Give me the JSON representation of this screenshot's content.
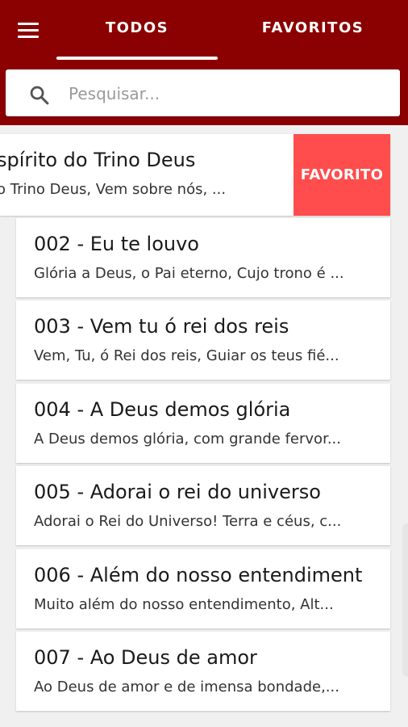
{
  "header": {
    "tabs": [
      {
        "label": "TODOS"
      },
      {
        "label": "FAVORITOS"
      }
    ],
    "active_tab": "TODOS",
    "colors": {
      "primary": "#8b0000",
      "favorite_action": "#ff4c4c"
    }
  },
  "search": {
    "placeholder": "Pesquisar...",
    "icon": "search-icon"
  },
  "swiped_item": {
    "title": "spírito do Trino Deus",
    "subtitle": "o Trino Deus, Vem sobre nós, ...",
    "action_label": "FAVORITO"
  },
  "hymns": [
    {
      "title": "002 - Eu te louvo",
      "subtitle": "Glória a Deus, o Pai eterno, Cujo trono é ..."
    },
    {
      "title": "003 - Vem tu ó rei dos reis",
      "subtitle": "Vem, Tu, ó Rei dos reis, Guiar os teus fié..."
    },
    {
      "title": "004 - A Deus demos glória",
      "subtitle": "A Deus demos glória, com grande fervor..."
    },
    {
      "title": "005 - Adorai o rei do universo",
      "subtitle": "Adorai o Rei do Universo! Terra e céus, c..."
    },
    {
      "title": "006 - Além do nosso entendiment",
      "subtitle": "Muito além do nosso entendimento, Alt..."
    },
    {
      "title": "007 - Ao Deus de amor",
      "subtitle": "Ao Deus de amor e de imensa bondade,..."
    }
  ]
}
